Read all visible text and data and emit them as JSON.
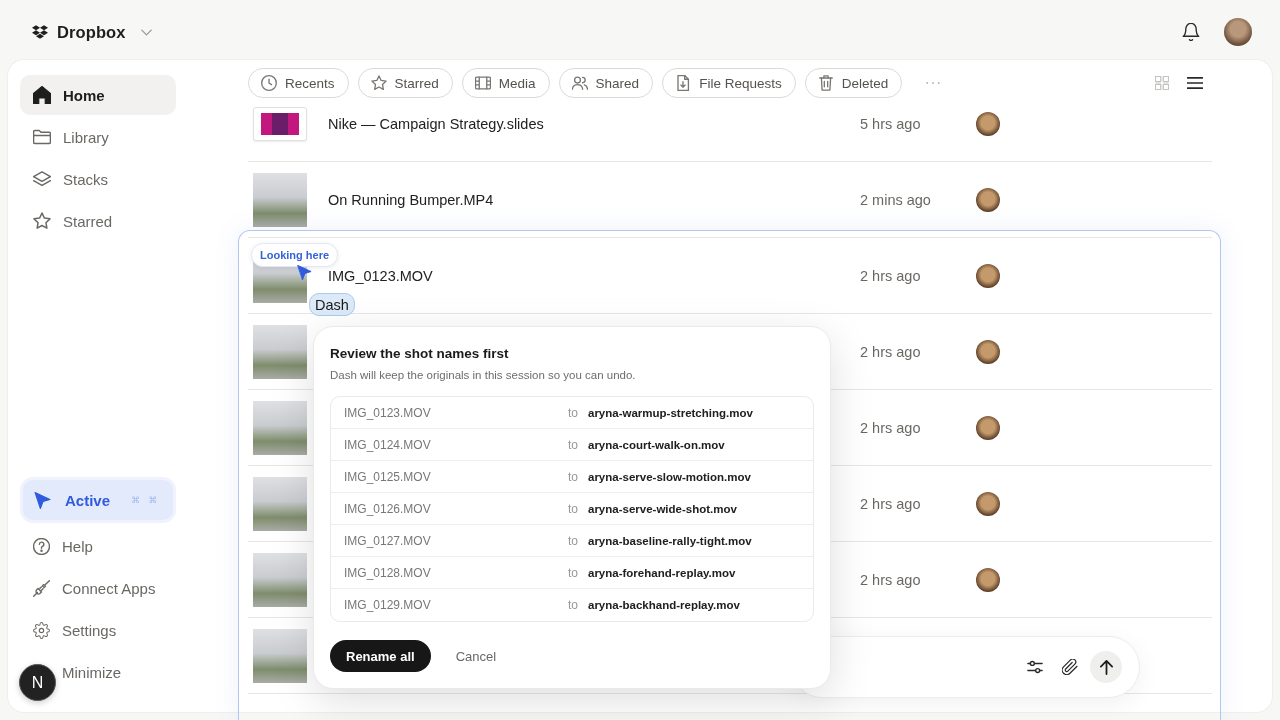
{
  "header": {
    "brand": "Dropbox"
  },
  "sidebar": {
    "items": [
      {
        "label": "Home",
        "selected": true
      },
      {
        "label": "Library",
        "selected": false
      },
      {
        "label": "Stacks",
        "selected": false
      },
      {
        "label": "Starred",
        "selected": false
      }
    ],
    "footer_items": [
      {
        "label": "Active",
        "selected": true,
        "shortcut": "⌘ ⌘"
      },
      {
        "label": "Help",
        "selected": false
      },
      {
        "label": "Connect Apps",
        "selected": false
      },
      {
        "label": "Settings",
        "selected": false
      },
      {
        "label": "Minimize",
        "selected": false
      }
    ]
  },
  "toolbar": {
    "filters": [
      {
        "label": "Recents",
        "selected": false
      },
      {
        "label": "Starred",
        "selected": false
      },
      {
        "label": "Media",
        "selected": false
      },
      {
        "label": "Shared",
        "selected": false
      },
      {
        "label": "File Requests",
        "selected": false
      },
      {
        "label": "Deleted",
        "selected": false
      }
    ],
    "view_modes": [
      {
        "kind": "grid",
        "selected": false
      },
      {
        "kind": "list",
        "selected": true
      }
    ]
  },
  "files": [
    {
      "kind": "slides",
      "name": "Nike — Campaign Strategy.slides",
      "modified": "5 hrs ago"
    },
    {
      "kind": "video",
      "name": "On Running Bumper.MP4",
      "modified": "2 mins ago"
    },
    {
      "kind": "video",
      "name": "IMG_0123.MOV",
      "modified": "2 hrs ago"
    },
    {
      "kind": "video",
      "modified": "2 hrs ago"
    },
    {
      "kind": "video",
      "modified": "2 hrs ago"
    },
    {
      "kind": "video",
      "modified": "2 hrs ago"
    },
    {
      "kind": "video",
      "modified": "2 hrs ago"
    },
    {
      "kind": "video"
    }
  ],
  "dash": {
    "pointer_label": "Looking here",
    "agent_label": "Dash",
    "dialog": {
      "title": "Review the shot names first",
      "subtitle": "Dash will keep the originals in this session so you can undo.",
      "renames": [
        {
          "from": "IMG_0123.MOV",
          "joiner": "to",
          "to": "aryna-warmup-stretching.mov"
        },
        {
          "from": "IMG_0124.MOV",
          "joiner": "to",
          "to": "aryna-court-walk-on.mov"
        },
        {
          "from": "IMG_0125.MOV",
          "joiner": "to",
          "to": "aryna-serve-slow-motion.mov"
        },
        {
          "from": "IMG_0126.MOV",
          "joiner": "to",
          "to": "aryna-serve-wide-shot.mov"
        },
        {
          "from": "IMG_0127.MOV",
          "joiner": "to",
          "to": "aryna-baseline-rally-tight.mov"
        },
        {
          "from": "IMG_0128.MOV",
          "joiner": "to",
          "to": "aryna-forehand-replay.mov"
        },
        {
          "from": "IMG_0129.MOV",
          "joiner": "to",
          "to": "aryna-backhand-replay.mov"
        }
      ],
      "confirm": "Rename all",
      "cancel": "Cancel"
    }
  },
  "dev_badge": {
    "letter": "N"
  }
}
